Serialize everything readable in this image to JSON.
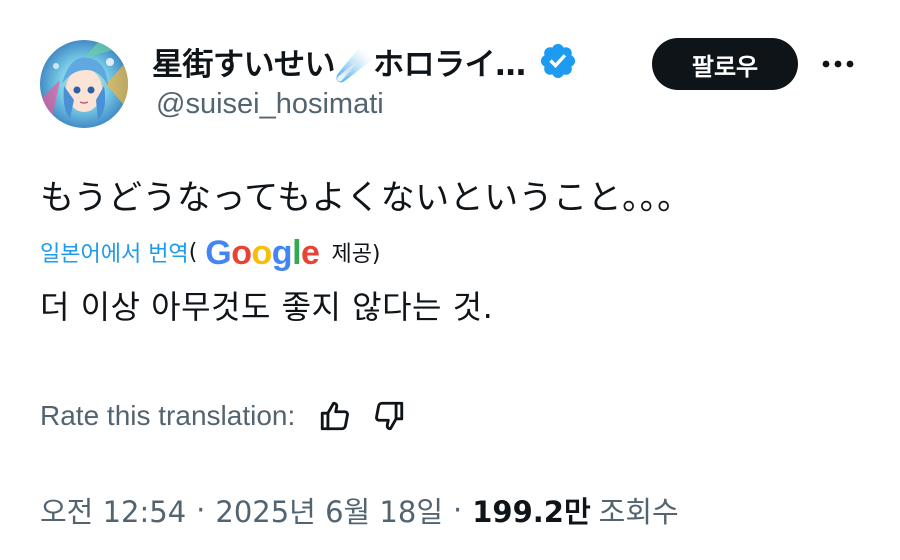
{
  "author": {
    "display_name": "星街すいせい☄️ホロライ…",
    "handle": "@suisei_hosimati",
    "verified_icon": "verified-badge-icon",
    "verified_color": "#1d9bf0",
    "avatar_icon": "avatar-illustration"
  },
  "actions": {
    "follow_label": "팔로우",
    "more_icon": "more-dots-icon"
  },
  "tweet": {
    "text": "もうどうなってもよくないということ。。。"
  },
  "translation": {
    "translated_from": "일본어에서 번역",
    "open_paren": "(",
    "provider_logo_text": "Google",
    "provided_by": "제공)",
    "text": "더 이상 아무것도 좋지 않다는 것."
  },
  "rating": {
    "label": "Rate this translation:",
    "thumbs_up_icon": "thumbs-up-icon",
    "thumbs_down_icon": "thumbs-down-icon"
  },
  "meta": {
    "time": "오전 12:54",
    "separator": "·",
    "date": "2025년 6월 18일",
    "views_count": "199.2만",
    "views_label": "조회수"
  },
  "colors": {
    "text_primary": "#0f1419",
    "text_secondary": "#536471",
    "accent": "#1d9bf0",
    "button_bg": "#0f1419"
  }
}
